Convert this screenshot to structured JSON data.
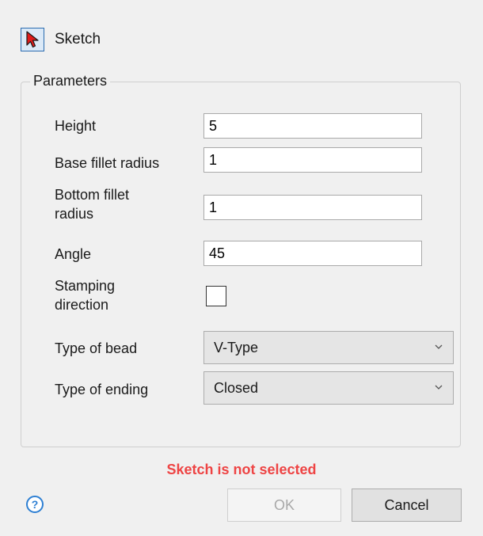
{
  "sketch": {
    "icon": "cursor-arrow-icon",
    "label": "Sketch"
  },
  "parameters": {
    "title": "Parameters",
    "height": {
      "label": "Height",
      "value": "5"
    },
    "base_fillet_radius": {
      "label": "Base fillet radius",
      "value": "1"
    },
    "bottom_fillet_radius": {
      "label_line1": "Bottom fillet",
      "label_line2": "radius",
      "value": "1"
    },
    "angle": {
      "label": "Angle",
      "value": "45"
    },
    "stamping_direction": {
      "label_line1": "Stamping",
      "label_line2": "direction",
      "checked": false
    },
    "type_of_bead": {
      "label": "Type of bead",
      "value": "V-Type"
    },
    "type_of_ending": {
      "label": "Type of ending",
      "value": "Closed"
    }
  },
  "status": {
    "text": "Sketch is not selected",
    "color": "#ee4444"
  },
  "footer": {
    "help_icon": "question-mark-icon",
    "help_glyph": "?",
    "ok_label": "OK",
    "cancel_label": "Cancel"
  },
  "colors": {
    "accent": "#2d7fd3",
    "cursor_icon": "#e01b1b"
  }
}
